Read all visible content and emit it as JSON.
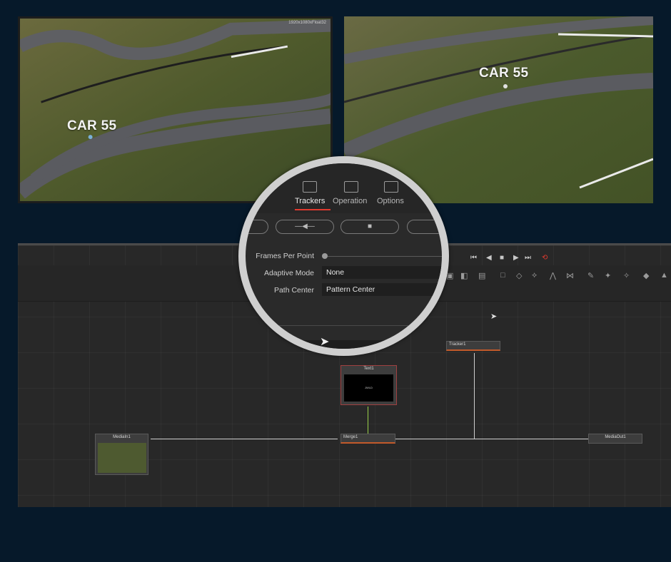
{
  "viewer_left": {
    "overlay_label": "CAR 55",
    "resolution_text": "1920x1080xFloat32"
  },
  "viewer_right": {
    "overlay_label": "CAR 55"
  },
  "inspector": {
    "tabs": [
      {
        "label": "Trackers",
        "icon": "tracker-icon",
        "active": true
      },
      {
        "label": "Operation",
        "icon": "operation-icon",
        "active": false
      },
      {
        "label": "Options",
        "icon": "options-icon",
        "active": false
      }
    ],
    "buttons": [
      {
        "label": "",
        "icon": "blank"
      },
      {
        "label": "—◀—",
        "icon": "track-backward-icon"
      },
      {
        "label": "■",
        "icon": "stop-icon"
      },
      {
        "label": "",
        "icon": "blank"
      }
    ],
    "fields": [
      {
        "label": "Frames Per Point",
        "type": "slider"
      },
      {
        "label": "Adaptive Mode",
        "value": "None"
      },
      {
        "label": "Path Center",
        "value": "Pattern Center"
      }
    ]
  },
  "transport_controls": [
    "⏮",
    "◀",
    "■",
    "▶",
    "⏭",
    "⟲"
  ],
  "nodes": {
    "text": "Text1",
    "tracker": "Tracker1",
    "media_in": "MediaIn1",
    "merge": "Merge1",
    "media_out": "MediaOut1",
    "text_preview": "JWLD"
  },
  "colors": {
    "accent": "#e03a2f",
    "background": "#06192a",
    "editor": "#282828"
  }
}
